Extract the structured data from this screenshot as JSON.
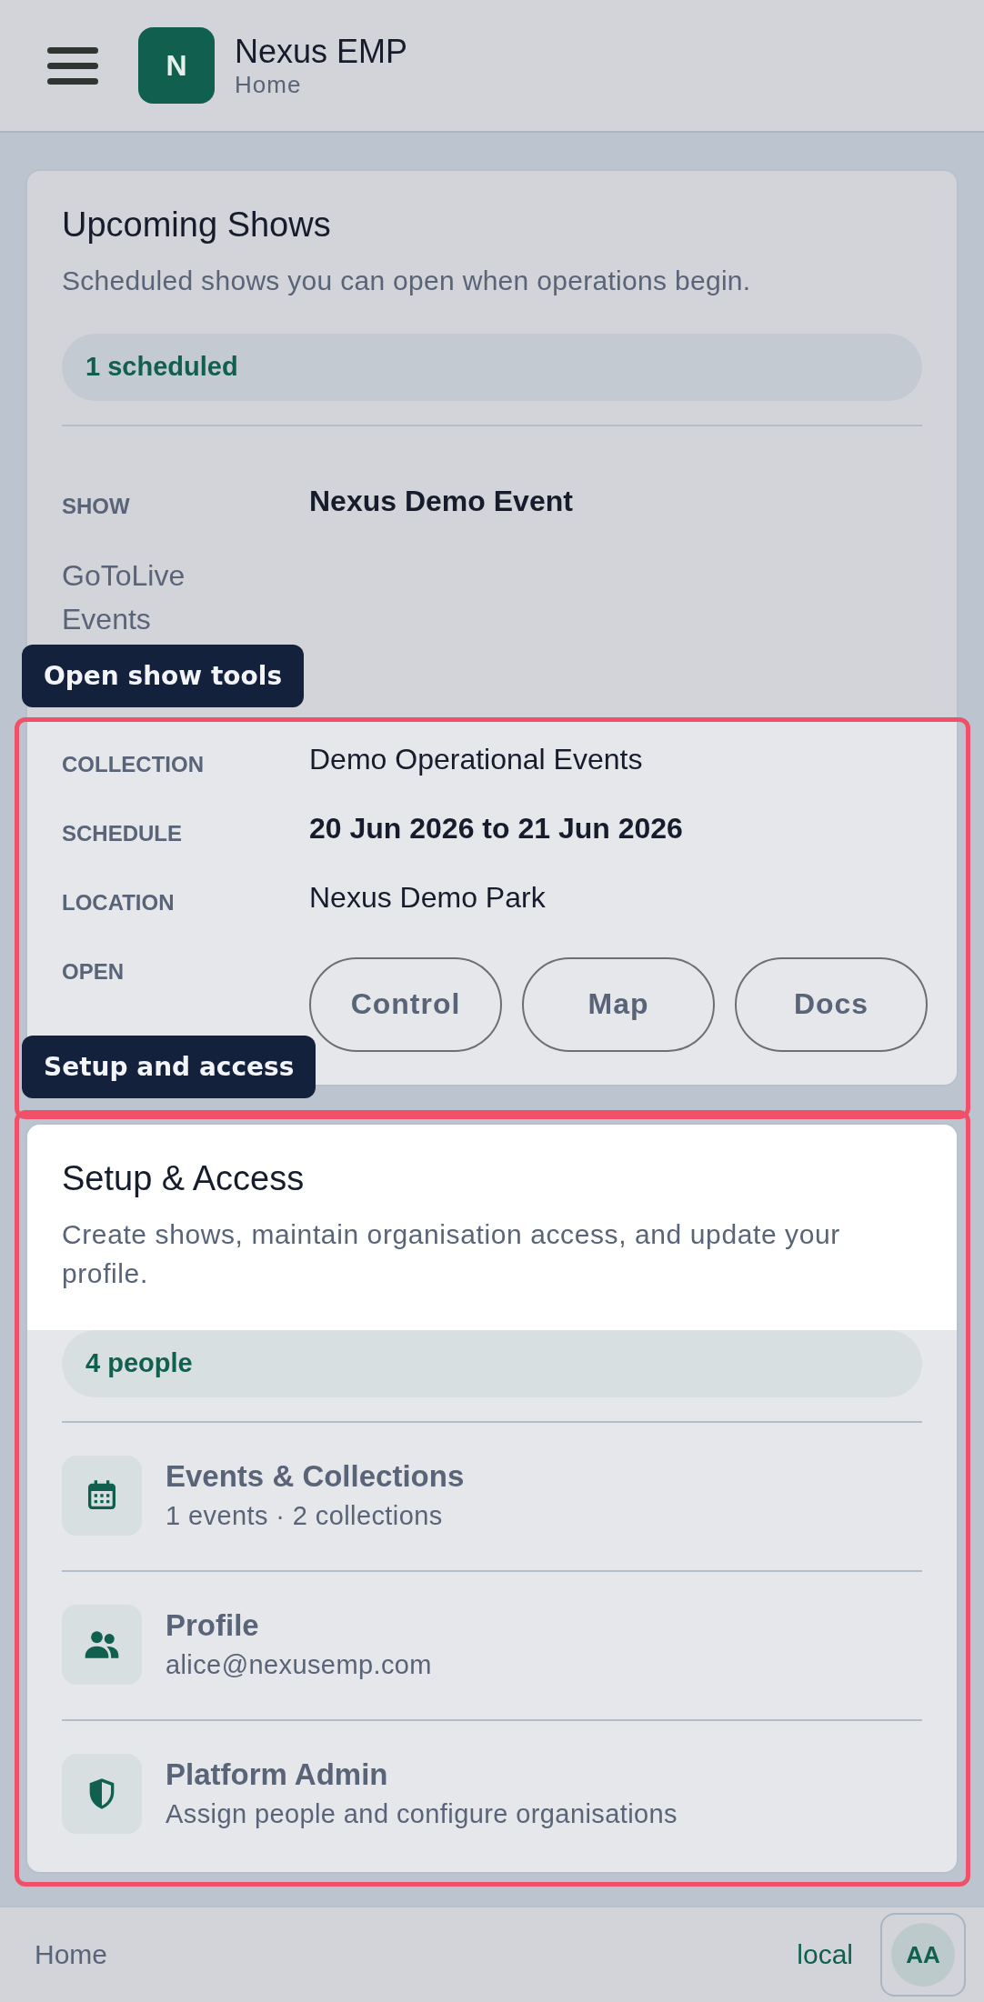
{
  "header": {
    "logo_letter": "N",
    "app_name": "Nexus EMP",
    "subtitle": "Home"
  },
  "upcoming": {
    "title": "Upcoming Shows",
    "description": "Scheduled shows you can open when operations begin.",
    "badge": "1 scheduled",
    "fields": [
      {
        "kind": "field",
        "label": "SHOW",
        "value": "Nexus Demo Event",
        "bold": true
      },
      {
        "kind": "org",
        "label": "GoToLive Events"
      },
      {
        "kind": "field",
        "label": "COLLECTION",
        "value": "Demo Operational Events",
        "bold": false
      },
      {
        "kind": "field",
        "label": "SCHEDULE",
        "value": "20 Jun 2026 to 21 Jun 2026",
        "bold": true
      },
      {
        "kind": "field",
        "label": "LOCATION",
        "value": "Nexus Demo Park",
        "bold": false
      },
      {
        "kind": "buttons",
        "label": "OPEN",
        "buttons": [
          "Control",
          "Map",
          "Docs"
        ]
      }
    ]
  },
  "tour": [
    {
      "label": "Open show tools"
    },
    {
      "label": "Setup and access"
    }
  ],
  "setup": {
    "title": "Setup & Access",
    "description": "Create shows, maintain organisation access, and update your profile.",
    "badge": "4 people",
    "items": [
      {
        "kind": "calendar",
        "title": "Events & Collections",
        "subtitle": "1 events · 2 collections"
      },
      {
        "kind": "people",
        "title": "Profile",
        "subtitle": "alice@nexusemp.com"
      },
      {
        "kind": "shield",
        "title": "Platform Admin",
        "subtitle": "Assign people and configure organisations"
      }
    ]
  },
  "footer": {
    "page": "Home",
    "environment": "local",
    "avatar": "AA"
  }
}
